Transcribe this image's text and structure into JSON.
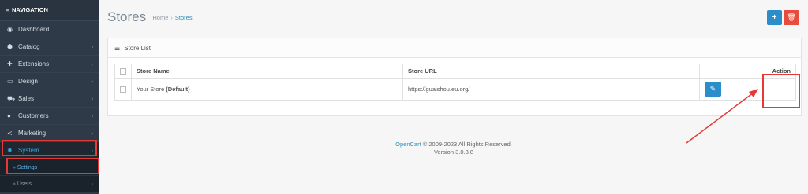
{
  "sidebar": {
    "header": "NAVIGATION",
    "items": [
      {
        "label": "Dashboard",
        "icon": "dashboard-icon",
        "glyph": "◉",
        "has_caret": false
      },
      {
        "label": "Catalog",
        "icon": "tag-icon",
        "glyph": "⬢",
        "has_caret": true
      },
      {
        "label": "Extensions",
        "icon": "puzzle-icon",
        "glyph": "✚",
        "has_caret": true
      },
      {
        "label": "Design",
        "icon": "monitor-icon",
        "glyph": "▭",
        "has_caret": true
      },
      {
        "label": "Sales",
        "icon": "cart-icon",
        "glyph": "⛟",
        "has_caret": true
      },
      {
        "label": "Customers",
        "icon": "user-icon",
        "glyph": "●",
        "has_caret": true
      },
      {
        "label": "Marketing",
        "icon": "share-icon",
        "glyph": "≺",
        "has_caret": true
      },
      {
        "label": "System",
        "icon": "gear-icon",
        "glyph": "✹",
        "has_caret": true,
        "active": true
      }
    ],
    "submenu": [
      {
        "label": "Settings",
        "active": true
      },
      {
        "label": "Users",
        "has_caret": true
      }
    ]
  },
  "page": {
    "title": "Stores",
    "breadcrumb": [
      "Home",
      "Stores"
    ],
    "breadcrumb_sep": "›"
  },
  "toolbar": {
    "add_glyph": "+",
    "delete_glyph": "🗑"
  },
  "panel": {
    "heading": "Store List",
    "columns": {
      "name": "Store Name",
      "url": "Store URL",
      "action": "Action"
    },
    "rows": [
      {
        "name": "Your Store",
        "name_suffix": "(Default)",
        "url": "https://guaishou.eu.org/"
      }
    ],
    "edit_glyph": "✎"
  },
  "footer": {
    "link": "OpenCart",
    "copyright": " © 2009-2023 All Rights Reserved.",
    "version": "Version 3.0.3.8"
  },
  "colors": {
    "sidebar_bg": "#2e3a47",
    "primary": "#2b8ecb",
    "danger": "#e74c3c",
    "annotation": "#e53935"
  }
}
